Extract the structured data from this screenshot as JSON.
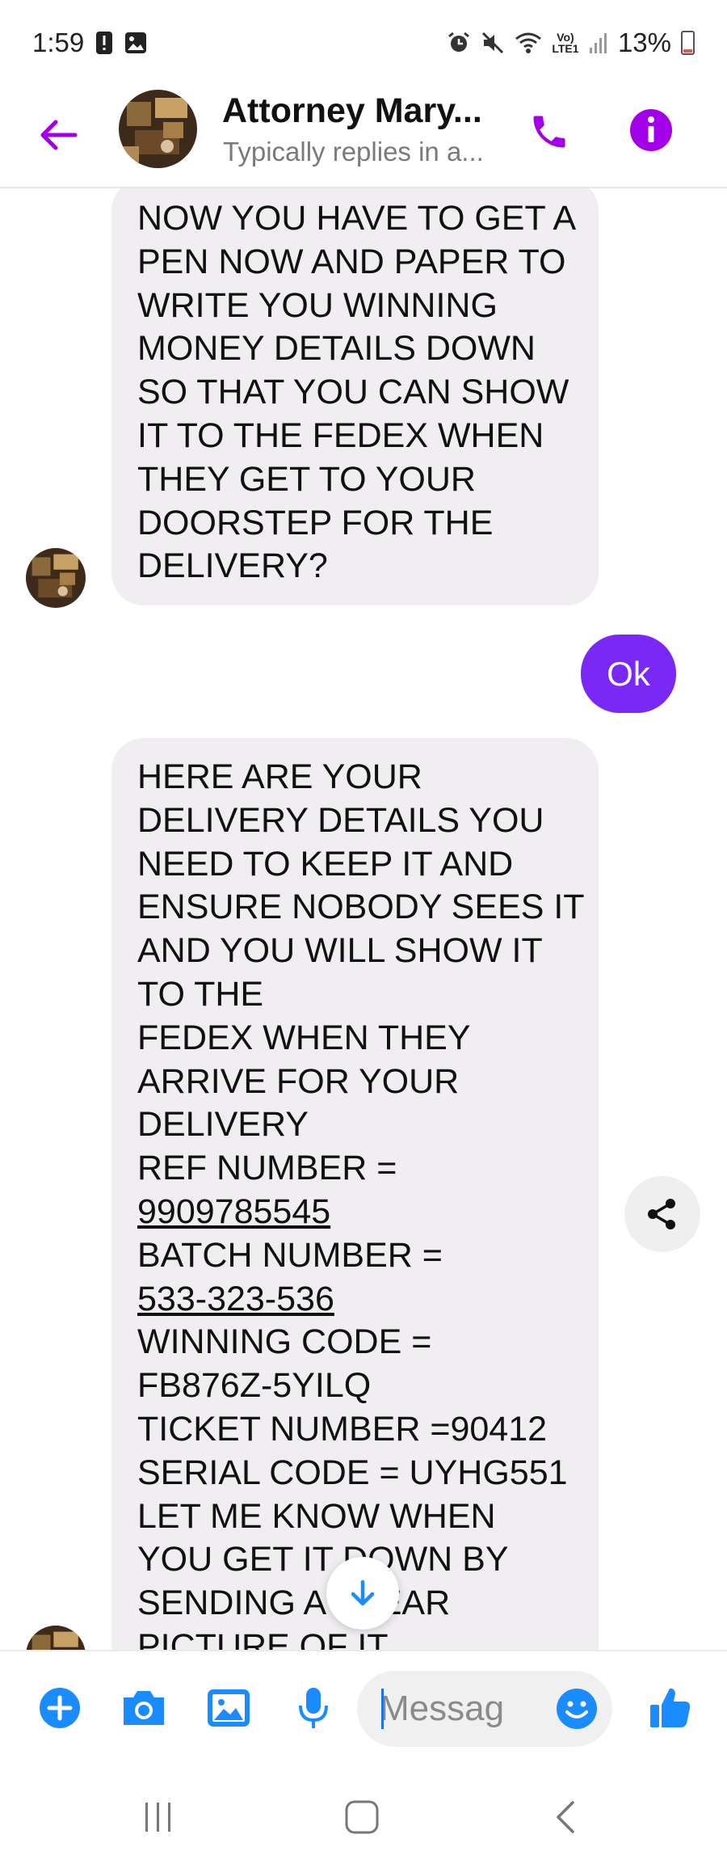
{
  "status_bar": {
    "time": "1:59",
    "network": "Vo) LTE1",
    "battery_percent": "13%",
    "left_icons": [
      "alert-icon",
      "image-icon"
    ],
    "right_icons": [
      "alarm-icon",
      "mute-icon",
      "wifi-icon",
      "signal-icon",
      "battery-icon"
    ]
  },
  "header": {
    "contact_name": "Attorney Mary...",
    "subtitle": "Typically replies in a...",
    "icons": [
      "back-arrow-icon",
      "phone-icon",
      "info-icon"
    ],
    "accent_color": "#a100e8"
  },
  "messages": {
    "msg1": {
      "sender": "contact",
      "lines": [
        "NOW YOU HAVE TO GET A",
        "PEN NOW AND PAPER TO",
        "WRITE YOU WINNING",
        "MONEY DETAILS DOWN",
        "SO THAT YOU CAN SHOW",
        "IT TO THE FEDEX WHEN",
        "THEY GET TO YOUR",
        "DOORSTEP FOR THE",
        "DELIVERY?"
      ]
    },
    "msg2": {
      "sender": "me",
      "text": "Ok"
    },
    "msg3": {
      "sender": "contact",
      "lines": [
        "HERE ARE YOUR",
        "DELIVERY DETAILS YOU",
        "NEED TO KEEP IT AND",
        "ENSURE NOBODY SEES IT",
        "AND YOU WILL SHOW IT",
        "TO THE",
        "FEDEX WHEN THEY",
        "ARRIVE FOR YOUR",
        "DELIVERY",
        "REF NUMBER =",
        "9909785545",
        "BATCH NUMBER =",
        "533-323-536",
        "WINNING CODE =",
        "FB876Z-5YILQ",
        "TICKET NUMBER =90412",
        "SERIAL CODE = UYHG551",
        "LET ME KNOW WHEN",
        "YOU GET IT DOWN BY",
        "SENDING A CLEAR",
        "PICTURE OF IT"
      ],
      "underlined_lines": [
        "9909785545",
        "533-323-536"
      ]
    }
  },
  "composer": {
    "placeholder": "Messag",
    "icons": [
      "plus-icon",
      "camera-icon",
      "gallery-icon",
      "mic-icon",
      "emoji-icon",
      "thumbs-up-icon"
    ],
    "icon_color": "#1a8cff"
  },
  "navbar": {
    "icons": [
      "recent-apps-icon",
      "home-icon",
      "back-icon"
    ]
  },
  "floating": {
    "share_icon": "share-icon",
    "scroll_icon": "arrow-down-icon"
  },
  "colors": {
    "outgoing_bubble": "#7a28f5",
    "incoming_bubble": "#f0eef1"
  }
}
